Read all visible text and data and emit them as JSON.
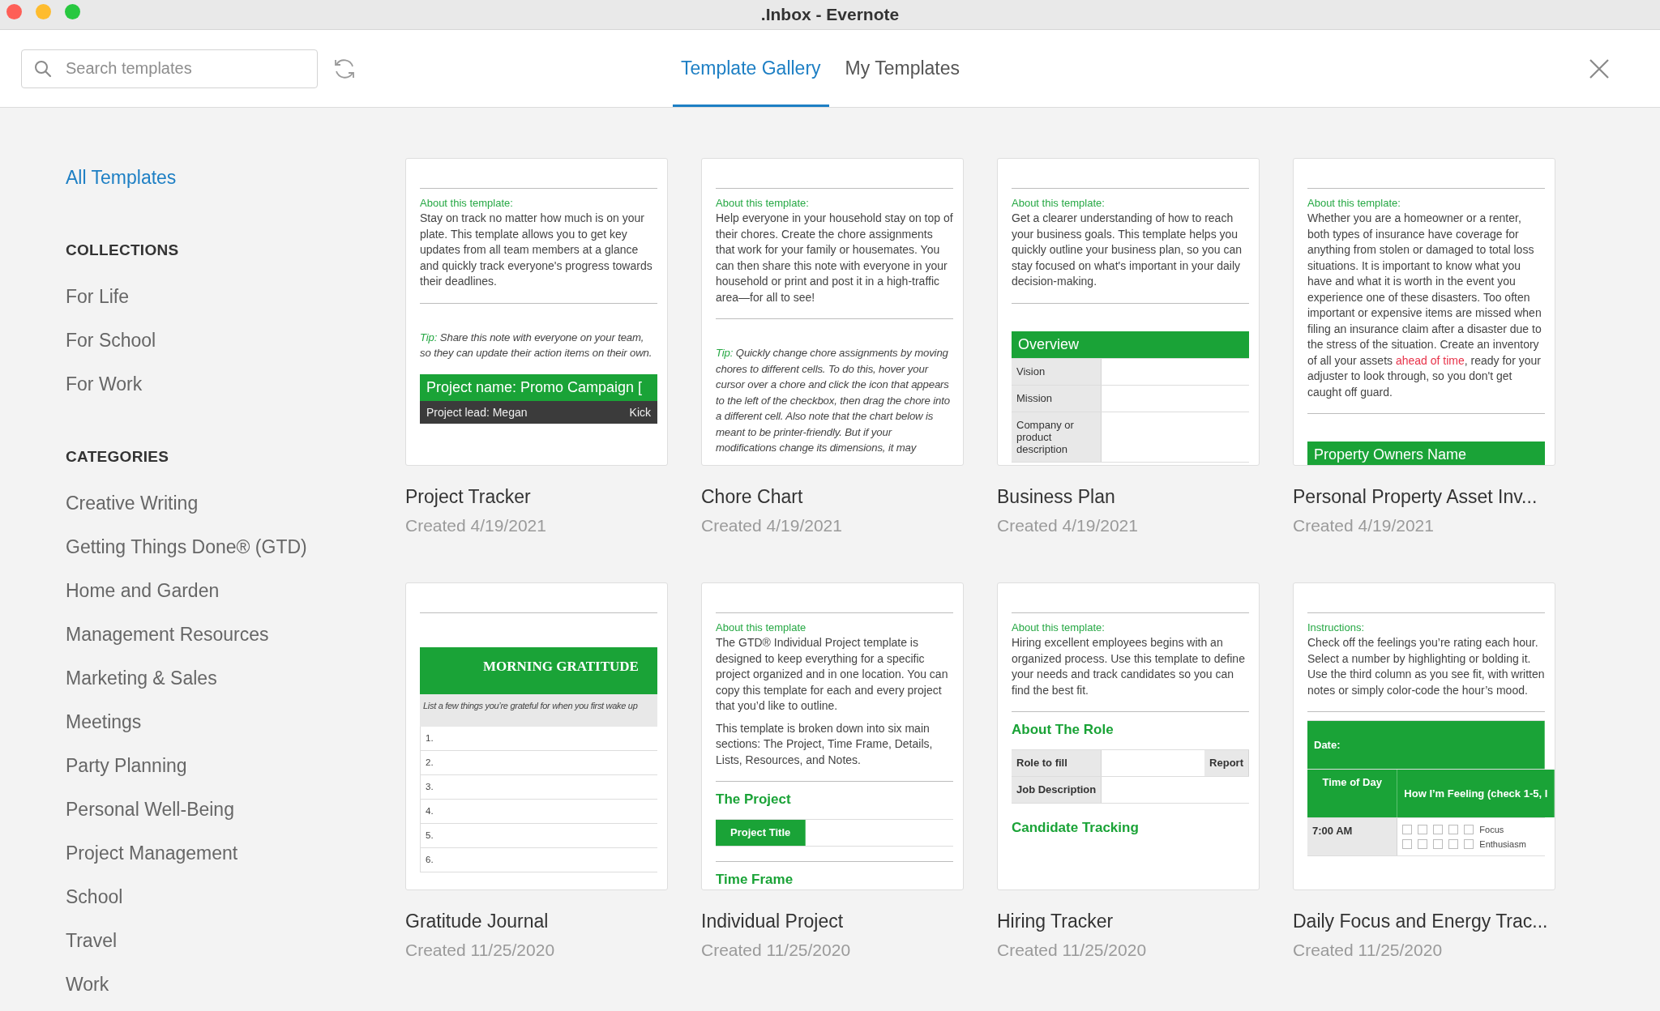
{
  "window": {
    "title": ".Inbox - Evernote"
  },
  "toolbar": {
    "search": {
      "placeholder": "Search templates"
    },
    "tabs": [
      {
        "label": "Template Gallery",
        "selected": true
      },
      {
        "label": "My Templates",
        "selected": false
      }
    ]
  },
  "sidebar": {
    "all": {
      "label": "All Templates",
      "selected": true
    },
    "sections": [
      {
        "heading": "COLLECTIONS",
        "items": [
          {
            "label": "For Life",
            "selected": false
          },
          {
            "label": "For School",
            "selected": false
          },
          {
            "label": "For Work",
            "selected": false
          }
        ]
      },
      {
        "heading": "CATEGORIES",
        "items": [
          {
            "label": "Creative Writing",
            "selected": false
          },
          {
            "label": "Getting Things Done® (GTD)",
            "selected": false
          },
          {
            "label": "Home and Garden",
            "selected": false
          },
          {
            "label": "Management Resources",
            "selected": false
          },
          {
            "label": "Marketing & Sales",
            "selected": false
          },
          {
            "label": "Meetings",
            "selected": false
          },
          {
            "label": "Party Planning",
            "selected": false
          },
          {
            "label": "Personal Well-Being",
            "selected": false
          },
          {
            "label": "Project Management",
            "selected": false
          },
          {
            "label": "School",
            "selected": false
          },
          {
            "label": "Travel",
            "selected": false
          },
          {
            "label": "Work",
            "selected": false
          }
        ]
      }
    ]
  },
  "templates": [
    {
      "name": "Project Tracker",
      "created": "Created 4/19/2021",
      "preview": [
        {
          "kind": "rule"
        },
        {
          "kind": "label",
          "text": "About this template:"
        },
        {
          "kind": "text",
          "text": "Stay on track no matter how much is on your plate. This template allows you to get key updates from all team members at a glance and quickly track everyone's progress towards their deadlines."
        },
        {
          "kind": "rule"
        },
        {
          "kind": "tip",
          "label": "Tip:",
          "text": "Share this note with everyone on your team, so they can update their action items on their own."
        },
        {
          "kind": "banner",
          "text": "Project name: Promo Campaign ["
        },
        {
          "kind": "darkbar",
          "cells": [
            "Project lead: Megan",
            "Kick"
          ]
        }
      ]
    },
    {
      "name": "Chore Chart",
      "created": "Created 4/19/2021",
      "preview": [
        {
          "kind": "rule"
        },
        {
          "kind": "label",
          "text": "About this template:"
        },
        {
          "kind": "text",
          "text": "Help everyone in your household stay on top of their chores. Create the chore assignments that work for your family or housemates. You can then share this note with everyone in your household or print and post it in a high-traffic area—for all to see!"
        },
        {
          "kind": "rule"
        },
        {
          "kind": "tip",
          "label": "Tip:",
          "text": "Quickly change chore assignments by moving chores to different cells. To do this, hover your cursor over a chore and click the icon that appears to the left of the checkbox, then drag the chore into a different cell. Also note that the chart below is meant to be printer-friendly. But if your modifications change its dimensions, it may"
        }
      ]
    },
    {
      "name": "Business Plan",
      "created": "Created 4/19/2021",
      "preview": [
        {
          "kind": "rule"
        },
        {
          "kind": "label",
          "text": "About this template:"
        },
        {
          "kind": "text",
          "text": "Get a clearer understanding of how to reach your business goals. This template helps you quickly outline your business plan, so you can stay focused on what's important in your daily decision-making."
        },
        {
          "kind": "rule"
        },
        {
          "kind": "banner",
          "text": "Overview"
        },
        {
          "kind": "table",
          "rows": [
            {
              "cells": [
                {
                  "kind": "label",
                  "text": "Vision"
                },
                {
                  "kind": "blank"
                }
              ]
            },
            {
              "cells": [
                {
                  "kind": "label",
                  "text": "Mission"
                },
                {
                  "kind": "blank"
                }
              ]
            },
            {
              "cells": [
                {
                  "kind": "label",
                  "text": "Company or product description"
                },
                {
                  "kind": "blank"
                }
              ]
            }
          ]
        }
      ]
    },
    {
      "name": "Personal Property Asset Inv...",
      "created": "Created 4/19/2021",
      "preview": [
        {
          "kind": "rule"
        },
        {
          "kind": "label",
          "text": "About this template:"
        },
        {
          "kind": "mixed_text",
          "segments": [
            {
              "text": "Whether you are a homeowner or a renter, both types of insurance have coverage for anything from stolen or damaged to total loss situations. It is important to know what you have and what it is worth in the event you experience one of these disasters. Too often important or expensive items are missed when filing an insurance claim after a disaster due to the stress of the situation. Create an inventory of all your assets ",
              "emphasis": false
            },
            {
              "text": "ahead of time",
              "emphasis": true
            },
            {
              "text": ", ready for your adjuster to look through, so you don't get caught off guard.",
              "emphasis": false
            }
          ]
        },
        {
          "kind": "rule"
        },
        {
          "kind": "banner",
          "text": "Property Owners Name"
        }
      ]
    },
    {
      "name": "Gratitude Journal",
      "created": "Created 11/25/2020",
      "preview": [
        {
          "kind": "rule"
        },
        {
          "kind": "title_banner",
          "text": "MORNING GRATITUDE"
        },
        {
          "kind": "note",
          "text": "List a few things you’re grateful for when you first wake up"
        },
        {
          "kind": "numbered",
          "items": [
            "1.",
            "2.",
            "3.",
            "4.",
            "5.",
            "6."
          ]
        }
      ]
    },
    {
      "name": "Individual Project",
      "created": "Created 11/25/2020",
      "preview": [
        {
          "kind": "rule"
        },
        {
          "kind": "label",
          "text": "About this template"
        },
        {
          "kind": "text",
          "text": "The GTD® Individual Project template is designed to keep everything for a specific project organized and in one location. You can copy this template for each and every project that you’d like to outline."
        },
        {
          "kind": "text",
          "text": "This template is broken down into six main sections: The Project, Time Frame, Details, Lists, Resources, and Notes."
        },
        {
          "kind": "rule"
        },
        {
          "kind": "heading",
          "text": "The Project"
        },
        {
          "kind": "table",
          "rows": [
            {
              "cells": [
                {
                  "kind": "label_green",
                  "text": "Project Title"
                },
                {
                  "kind": "blank"
                }
              ]
            }
          ]
        },
        {
          "kind": "rule"
        },
        {
          "kind": "heading",
          "text": "Time Frame"
        }
      ]
    },
    {
      "name": "Hiring Tracker",
      "created": "Created 11/25/2020",
      "preview": [
        {
          "kind": "rule"
        },
        {
          "kind": "label",
          "text": "About this template:"
        },
        {
          "kind": "text",
          "text": "Hiring excellent employees begins with an organized process. Use this template to define your needs and track candidates so you can find the best fit."
        },
        {
          "kind": "rule"
        },
        {
          "kind": "heading",
          "text": "About The Role"
        },
        {
          "kind": "table",
          "rows": [
            {
              "cells": [
                {
                  "kind": "strong_label",
                  "text": "Role to fill"
                },
                {
                  "kind": "blank"
                },
                {
                  "kind": "strong_label",
                  "text": "Report"
                }
              ]
            },
            {
              "cells": [
                {
                  "kind": "strong_label",
                  "text": "Job Description"
                },
                {
                  "kind": "blank"
                }
              ]
            }
          ]
        },
        {
          "kind": "heading",
          "text": "Candidate Tracking"
        }
      ]
    },
    {
      "name": "Daily Focus and Energy Trac...",
      "created": "Created 11/25/2020",
      "preview": [
        {
          "kind": "rule"
        },
        {
          "kind": "label",
          "text": "Instructions:"
        },
        {
          "kind": "text",
          "text": "Check off the feelings you’re rating each hour. Select a number by highlighting or bolding it. Use the third column as you see fit, with written notes or simply color-code the hour’s mood."
        },
        {
          "kind": "rule"
        },
        {
          "kind": "table",
          "rows": [
            {
              "cells": [
                {
                  "kind": "fill_green",
                  "text": "Date:"
                }
              ]
            },
            {
              "cells": [
                {
                  "kind": "label_green",
                  "text": "Time of Day"
                },
                {
                  "kind": "fill_green",
                  "text": "How I’m Feeling (check 1-5, l"
                }
              ]
            },
            {
              "cells": [
                {
                  "kind": "strong_label",
                  "text": "7:00 AM"
                },
                {
                  "kind": "checks",
                  "items": [
                    "Focus",
                    "Enthusiasm"
                  ]
                }
              ]
            }
          ]
        }
      ]
    }
  ]
}
